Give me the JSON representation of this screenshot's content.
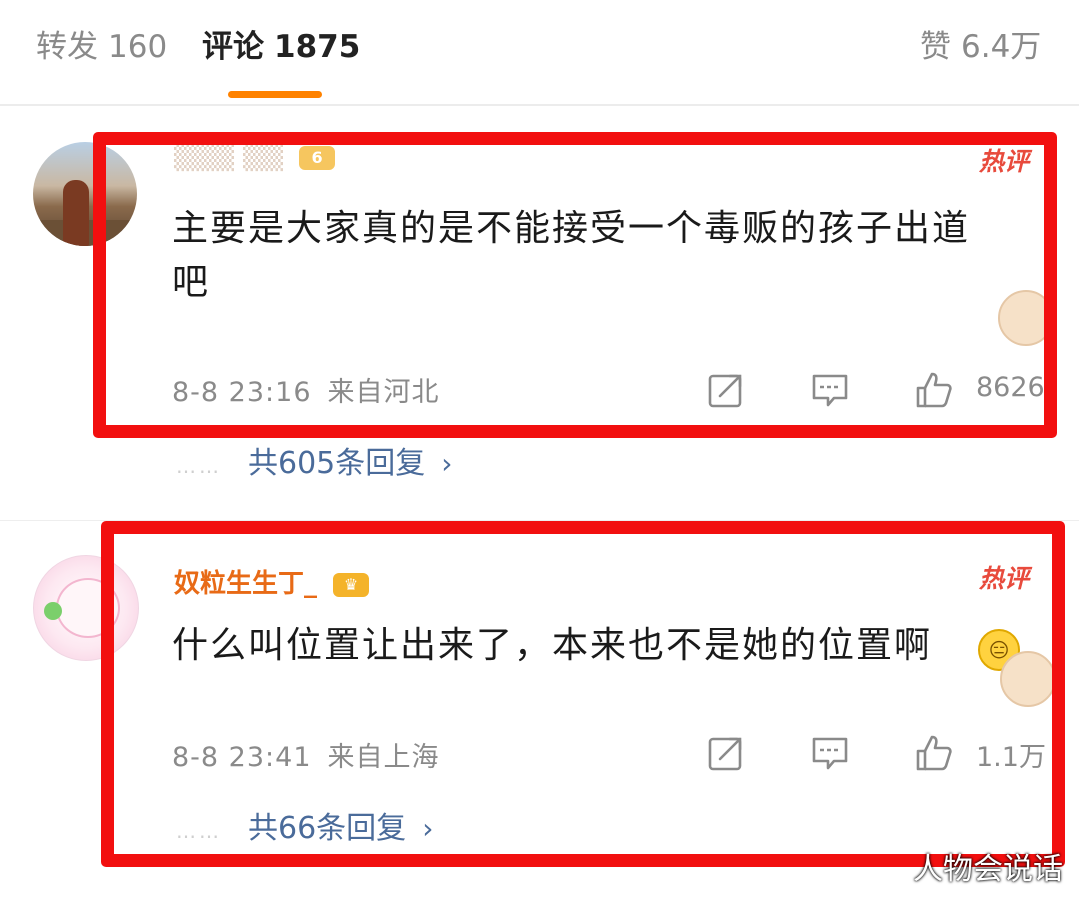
{
  "tabs": {
    "repost": {
      "label": "转发",
      "count": "160"
    },
    "comments": {
      "label": "评论",
      "count": "1875"
    },
    "likes": {
      "label": "赞",
      "count": "6.4万"
    }
  },
  "comments": [
    {
      "hot_label": "热评",
      "text": "主要是大家真的是不能接受一个毒贩的孩子出道吧",
      "time": "8-8 23:16",
      "location": "来自河北",
      "like_count": "8626",
      "replies": "共605条回复"
    },
    {
      "username": "奴粒生生丁_",
      "hot_label": "热评",
      "text": "什么叫位置让出来了，本来也不是她的位置啊",
      "time": "8-8 23:41",
      "location": "来自上海",
      "like_count": "1.1万",
      "replies": "共66条回复"
    }
  ],
  "icons": {
    "share": "share-icon",
    "comment": "comment-icon",
    "like": "thumbs-up-icon",
    "chevron": "chevron-right-icon"
  },
  "colors": {
    "accent": "#ff8200",
    "annotation": "#f20f0f",
    "hot": "#e84a3c",
    "link": "#4a6b9a"
  },
  "watermark": "人物会说话"
}
